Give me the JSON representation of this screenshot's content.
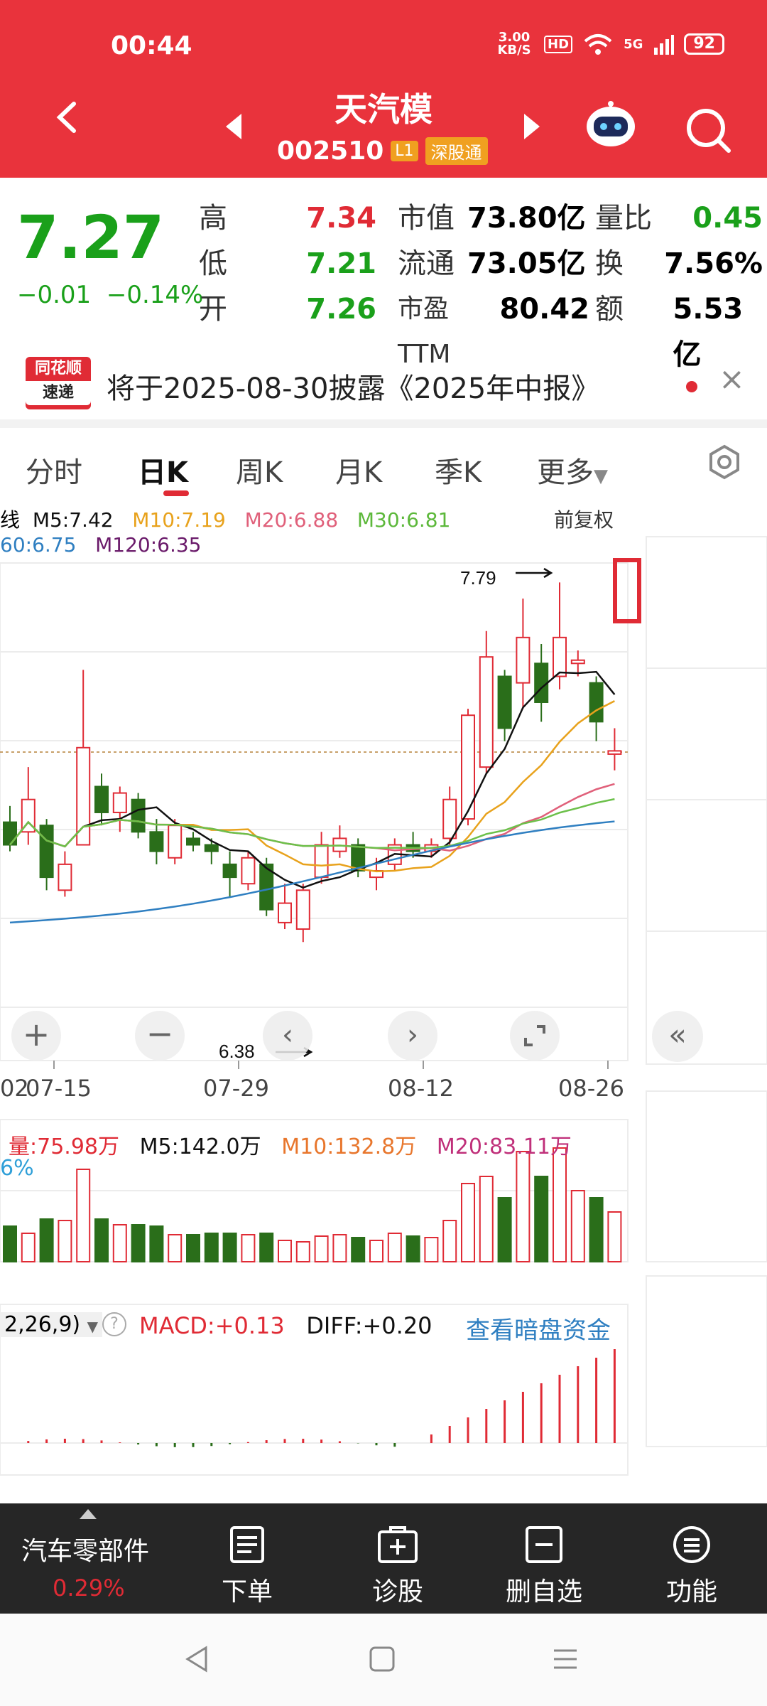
{
  "status": {
    "time": "00:44",
    "speed": "3.00 KB/S",
    "hd": "HD",
    "signal": "5G",
    "battery": "92"
  },
  "header": {
    "title": "天汽模",
    "code": "002510",
    "level_tag": "L1",
    "market_tag": "深股通"
  },
  "quote": {
    "price": "7.27",
    "change": "−0.01",
    "change_pct": "−0.14%",
    "high_label": "高",
    "high": "7.34",
    "low_label": "低",
    "low": "7.21",
    "open_label": "开",
    "open": "7.26",
    "mcap_label": "市值",
    "mcap": "73.80亿",
    "float_label": "流通",
    "float": "73.05亿",
    "pe_label": "市盈TTM",
    "pe": "80.42",
    "vr_label": "量比",
    "vr": "0.45",
    "turn_label": "换",
    "turn": "7.56%",
    "amt_label": "额",
    "amt": "5.53亿"
  },
  "notice": {
    "badge_top": "同花顺",
    "badge_bottom": "速递",
    "text": "将于2025-08-30披露《2025年中报》"
  },
  "tabs": [
    "分时",
    "日K",
    "周K",
    "月K",
    "季K",
    "更多"
  ],
  "chart": {
    "ma_line1": {
      "prefix": "线",
      "m5": "M5:7.42",
      "m10": "M10:7.19",
      "m20": "M20:6.88",
      "m30": "M30:6.81"
    },
    "ma_line2": {
      "m60": "60:6.75",
      "m120": "M120:6.35"
    },
    "adjust": "前复权",
    "high_marker": "7.79",
    "low_marker": "6.38",
    "dates": [
      "07-15",
      "07-29",
      "08-12",
      "08-26"
    ],
    "date_prefix": "02",
    "vol": {
      "label": "量:75.98万",
      "m5": "M5:142.0万",
      "m10": "M10:132.8万",
      "m20": "M20:83.11万",
      "extra": "6%"
    },
    "macd": {
      "param": "2,26,9)",
      "macd": "MACD:+0.13",
      "diff": "DIFF:+0.20",
      "link": "查看暗盘资金"
    },
    "colors": {
      "up": "#e02b35",
      "down": "#2a6e1a",
      "m5": "#111111",
      "m10": "#e8a21c",
      "m20": "#e0607a",
      "m30": "#6cc04a",
      "m60": "#2f7fc1"
    }
  },
  "bottom": {
    "sector": "汽车零部件",
    "sector_pct": "0.29%",
    "order": "下单",
    "diagnose": "诊股",
    "remove": "删自选",
    "func": "功能"
  }
}
